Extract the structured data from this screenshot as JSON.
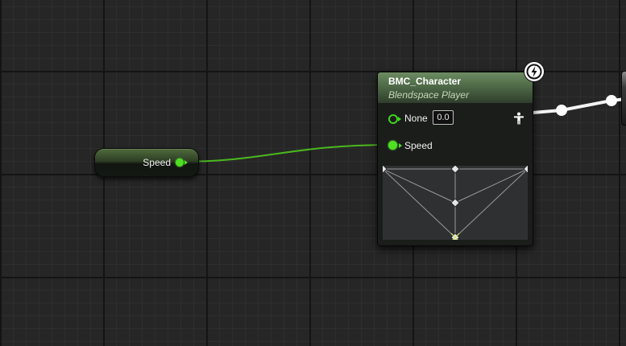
{
  "variable_node": {
    "label": "Speed",
    "pin_color": "#4ee021",
    "header_color": "#4f6b3d"
  },
  "blendspace_node": {
    "title": "BMC_Character",
    "subtitle": "Blendspace Player",
    "header_color": "#5a7a52",
    "inputs": [
      {
        "label": "None",
        "value": "0.0",
        "pin": "hollow"
      },
      {
        "label": "Speed",
        "pin": "filled"
      }
    ],
    "output_icon": "pose-figure-icon",
    "badge_icon": "lightning-icon"
  },
  "colors": {
    "float_wire": "#4ee021",
    "exec_wire": "#ffffff",
    "grid_background": "#262626"
  }
}
